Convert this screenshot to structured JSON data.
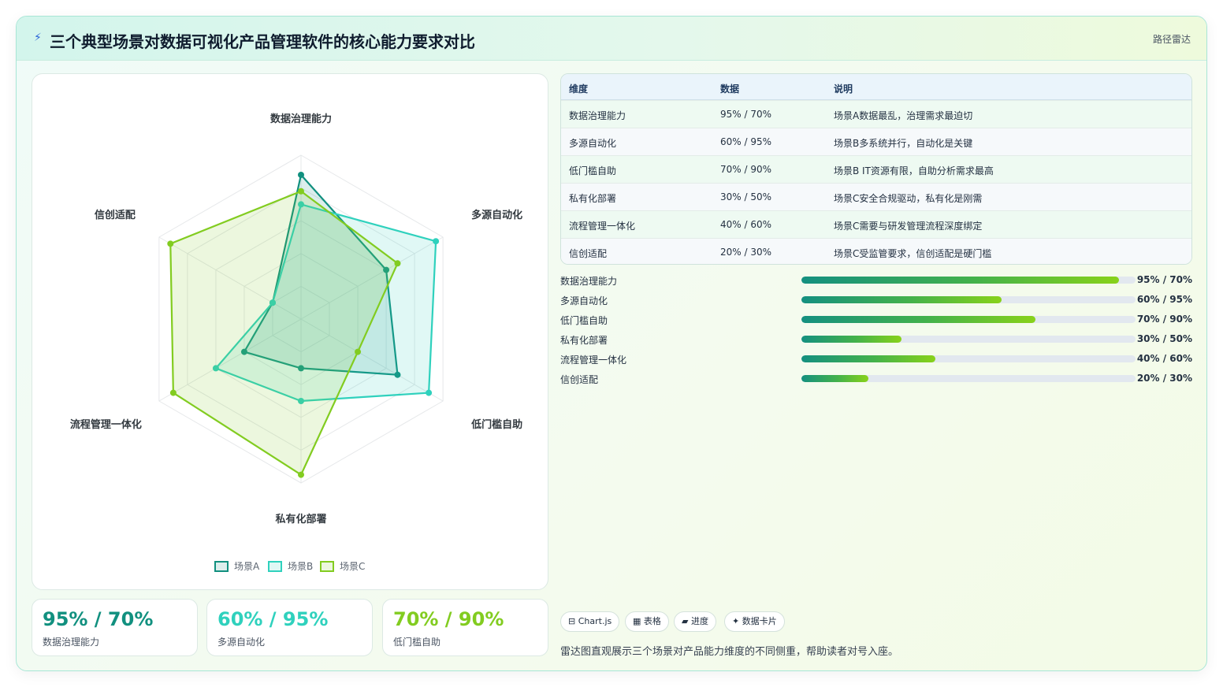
{
  "header": {
    "title": "三个典型场景对数据可视化产品管理软件的核心能力要求对比",
    "tag": "路径雷达"
  },
  "chart_data": {
    "type": "radar",
    "categories": [
      "数据治理能力",
      "多源自动化",
      "低门槛自助",
      "私有化部署",
      "流程管理一体化",
      "信创适配"
    ],
    "series": [
      {
        "name": "场景A",
        "color": "#11907f",
        "values": [
          88,
          60,
          68,
          30,
          40,
          20
        ]
      },
      {
        "name": "场景B",
        "color": "#2fd1bd",
        "values": [
          70,
          95,
          90,
          50,
          60,
          20
        ]
      },
      {
        "name": "场景C",
        "color": "#82cc20",
        "values": [
          78,
          68,
          40,
          95,
          90,
          92
        ]
      }
    ],
    "rmax": 100,
    "rings": 5,
    "legend_position": "bottom"
  },
  "table": {
    "headers": [
      "维度",
      "数据",
      "说明"
    ],
    "rows": [
      [
        "数据治理能力",
        "95% / 70%",
        "场景A数据最乱，治理需求最迫切"
      ],
      [
        "多源自动化",
        "60% / 95%",
        "场景B多系统并行，自动化是关键"
      ],
      [
        "低门槛自助",
        "70% / 90%",
        "场景B IT资源有限，自助分析需求最高"
      ],
      [
        "私有化部署",
        "30% / 50%",
        "场景C安全合规驱动，私有化是刚需"
      ],
      [
        "流程管理一体化",
        "40% / 60%",
        "场景C需要与研发管理流程深度绑定"
      ],
      [
        "信创适配",
        "20% / 30%",
        "场景C受监管要求，信创适配是硬门槛"
      ]
    ]
  },
  "progress": [
    {
      "label": "数据治理能力",
      "value": 0.95,
      "text": "95% / 70%"
    },
    {
      "label": "多源自动化",
      "value": 0.6,
      "text": "60% / 95%"
    },
    {
      "label": "低门槛自助",
      "value": 0.7,
      "text": "70% / 90%"
    },
    {
      "label": "私有化部署",
      "value": 0.3,
      "text": "30% / 50%"
    },
    {
      "label": "流程管理一体化",
      "value": 0.4,
      "text": "40% / 60%"
    },
    {
      "label": "信创适配",
      "value": 0.2,
      "text": "20% / 30%"
    }
  ],
  "stats": [
    {
      "value": "95% / 70%",
      "label": "数据治理能力",
      "color": "#11907f"
    },
    {
      "value": "60% / 95%",
      "label": "多源自动化",
      "color": "#2fd1bd"
    },
    {
      "value": "70% / 90%",
      "label": "低门槛自助",
      "color": "#82cc20"
    }
  ],
  "chips": [
    {
      "icon": "⊟",
      "icon_name": "chart-icon",
      "label": "Chart.js"
    },
    {
      "icon": "▦",
      "icon_name": "table-icon",
      "label": "表格"
    },
    {
      "icon": "▰",
      "icon_name": "progress-icon",
      "label": "进度"
    },
    {
      "icon": "✦",
      "icon_name": "card-icon",
      "label": "数据卡片"
    }
  ],
  "note": "雷达图直观展示三个场景对产品能力维度的不同侧重，帮助读者对号入座。"
}
